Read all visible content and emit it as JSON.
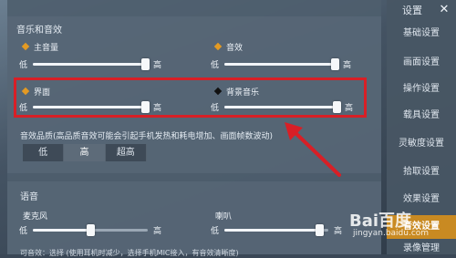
{
  "sidebar": {
    "close_symbol": "✕",
    "items": [
      {
        "label": "设置"
      },
      {
        "label": "基础设置"
      },
      {
        "label": "画面设置"
      },
      {
        "label": "操作设置"
      },
      {
        "label": "载具设置"
      },
      {
        "label": "灵敏度设置"
      },
      {
        "label": "拾取设置"
      },
      {
        "label": "效果设置"
      },
      {
        "label": "音效设置"
      },
      {
        "label": "录像管理"
      }
    ]
  },
  "audio": {
    "section_title": "音乐和音效",
    "low": "低",
    "high": "高",
    "sliders": [
      {
        "label": "主音量",
        "level": 0.98
      },
      {
        "label": "音效",
        "level": 0.98
      },
      {
        "label": "界面",
        "level": 0.98
      },
      {
        "label": "背景音乐",
        "level": 0.98
      }
    ],
    "quality_label": "音效品质(高品质音效可能会引起手机发热和耗电增加、画面帧数波动)",
    "quality_options": [
      "低",
      "高",
      "超高"
    ],
    "quality_selected": "高"
  },
  "voice": {
    "section_title": "语音",
    "sliders": [
      {
        "label": "麦克风",
        "level": 0.5
      },
      {
        "label": "喇叭",
        "level": 0.92
      }
    ],
    "bottom_text": "可音效：选择  (使用耳机时减少，选择手机MIC接入，有音效清晰度)"
  },
  "watermark": {
    "text": "Bai百度",
    "url": "jingyan.baidu.com"
  },
  "colors": {
    "accent": "#c98a22",
    "highlight": "#d81f26",
    "diamond_orange": "#e39a23"
  }
}
